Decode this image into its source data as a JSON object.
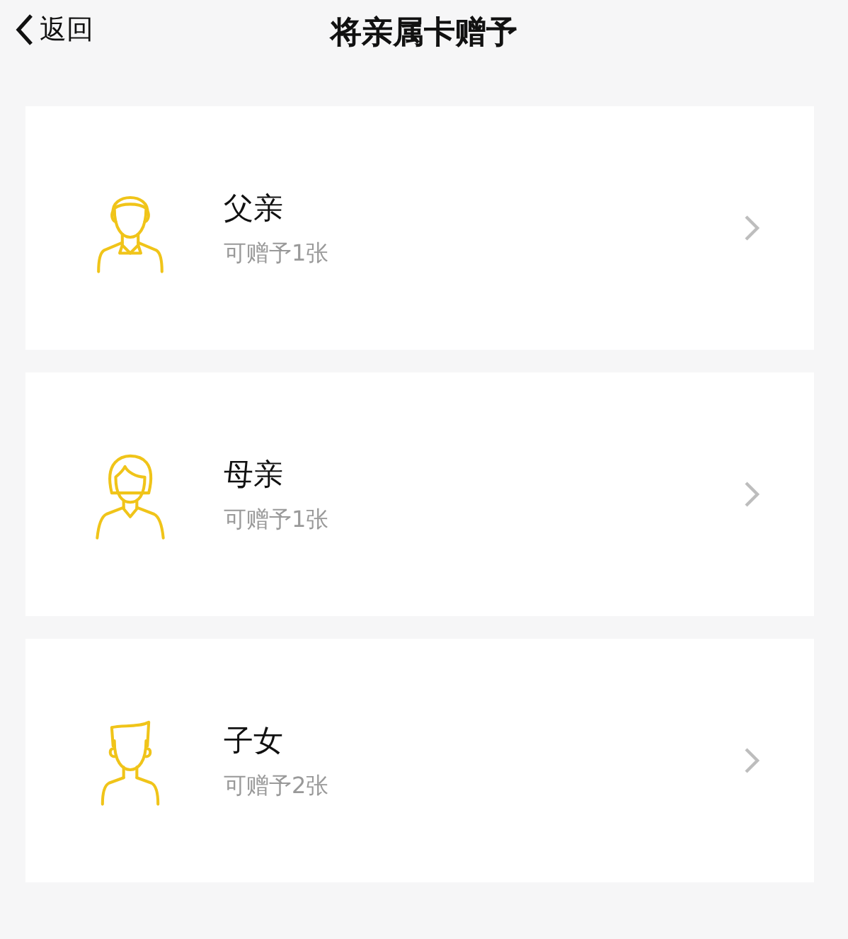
{
  "nav_bar": {
    "back_label": "返回",
    "title": "将亲属卡赠予"
  },
  "recipients": [
    {
      "kind": "father",
      "name": "父亲",
      "quota": "可赠予1张"
    },
    {
      "kind": "mother",
      "name": "母亲",
      "quota": "可赠予1张"
    },
    {
      "kind": "child",
      "name": "子女",
      "quota": "可赠予2张"
    }
  ]
}
